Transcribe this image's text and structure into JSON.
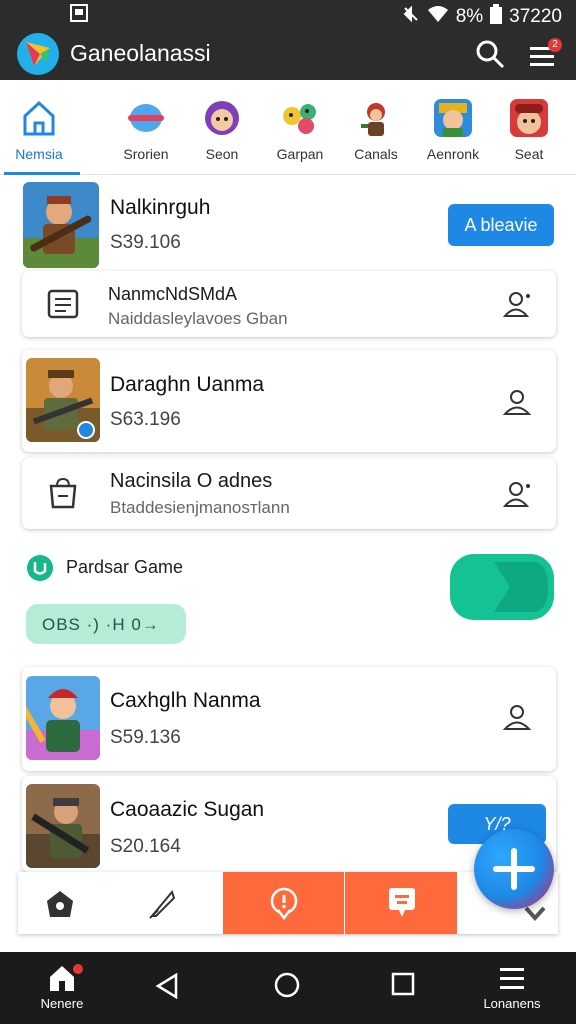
{
  "status": {
    "battery": "8%",
    "time": "37220"
  },
  "app": {
    "title": "Ganeolanassi",
    "menu_badge": "2"
  },
  "categories": [
    {
      "label": "Nemsia",
      "icon": "home-outline-icon",
      "active": true
    },
    {
      "label": "Srorien",
      "icon": "capsule-icon"
    },
    {
      "label": "Seon",
      "icon": "avatar-girl-icon"
    },
    {
      "label": "Garpan",
      "icon": "character-group-icon"
    },
    {
      "label": "Canals",
      "icon": "warrior-icon"
    },
    {
      "label": "Aenronk",
      "icon": "hero-portrait-icon"
    },
    {
      "label": "Seat",
      "icon": "red-cap-hero-icon"
    }
  ],
  "items": [
    {
      "title": "Nalkinrguh",
      "price": "S39.106",
      "button": "A bleavie"
    },
    {
      "title": "NanmcNdSMdA",
      "subtitle": "Naiddasleylavoes Gban"
    },
    {
      "title": "Daraghn Uanma",
      "price": "S63.196"
    },
    {
      "title": "Nacinsila O adnes",
      "subtitle": "Btaddesienjmanosтlann"
    },
    {
      "title": "Caxhglh Nanma",
      "price": "S59.136"
    },
    {
      "title": "Caoaazic Sugan",
      "price": "S20.164",
      "button": "Y/?"
    }
  ],
  "promo": {
    "label": "Pardsar Game",
    "pill_text": "OBS ·) ·H 0→"
  },
  "bottom_tabs": [
    {
      "icon": "home-shield-icon"
    },
    {
      "icon": "feather-pen-icon"
    },
    {
      "icon": "location-pin-icon"
    },
    {
      "icon": "chat-bubble-icon"
    },
    {
      "icon": "favorite-icon"
    }
  ],
  "navbar": {
    "home_label": "Nenere",
    "menu_label": "Lonanens"
  },
  "colors": {
    "accent": "#1e88e5",
    "toggle": "#14c293",
    "tab_highlight": "#ff6a3d",
    "dark": "#2c2c2c"
  }
}
